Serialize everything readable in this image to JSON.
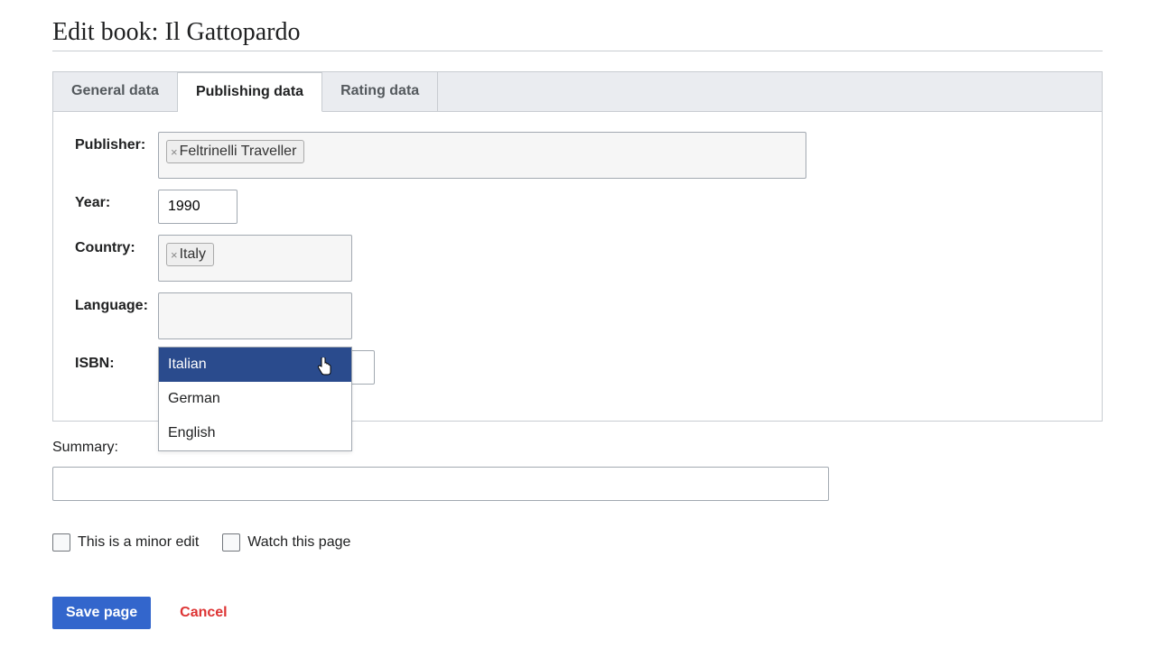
{
  "page_title": "Edit book: Il Gattopardo",
  "tabs": {
    "general": "General data",
    "publishing": "Publishing data",
    "rating": "Rating data"
  },
  "fields": {
    "publisher": {
      "label": "Publisher:",
      "tokens": [
        "Feltrinelli Traveller"
      ]
    },
    "year": {
      "label": "Year:",
      "value": "1990"
    },
    "country": {
      "label": "Country:",
      "tokens": [
        "Italy"
      ]
    },
    "language": {
      "label": "Language:",
      "value": ""
    },
    "isbn": {
      "label": "ISBN:",
      "value": ""
    }
  },
  "language_dropdown": {
    "options": [
      "Italian",
      "German",
      "English"
    ],
    "highlighted_index": 0
  },
  "summary": {
    "label": "Summary:",
    "value": ""
  },
  "checkboxes": {
    "minor_edit": "This is a minor edit",
    "watch_page": "Watch this page"
  },
  "buttons": {
    "save": "Save page",
    "cancel": "Cancel"
  }
}
